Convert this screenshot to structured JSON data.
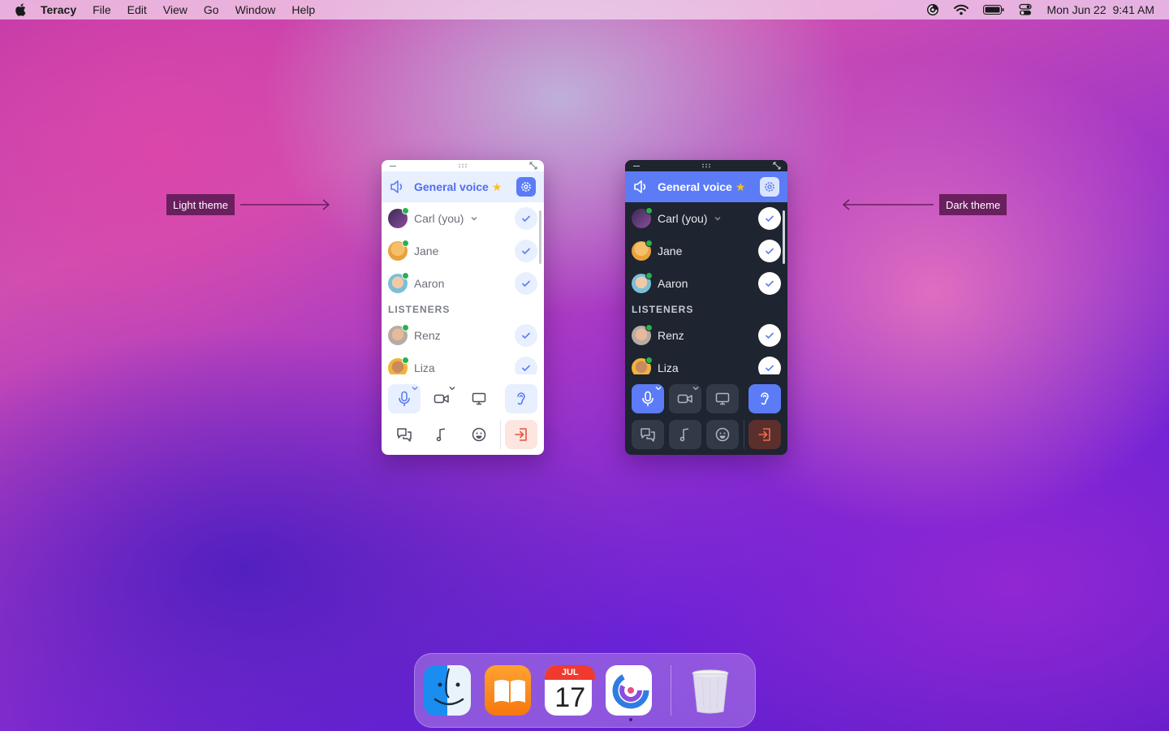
{
  "menubar": {
    "app_name": "Teracy",
    "items": [
      "File",
      "Edit",
      "View",
      "Go",
      "Window",
      "Help"
    ],
    "date": "Mon Jun 22",
    "time": "9:41 AM",
    "status_icons": [
      "teracy-icon",
      "wifi-icon",
      "battery-icon",
      "control-center-icon"
    ]
  },
  "annotations": {
    "light": "Light theme",
    "dark": "Dark theme"
  },
  "widget": {
    "channel": "General voice",
    "participants": [
      {
        "name": "Carl (you)",
        "self": true
      },
      {
        "name": "Jane"
      },
      {
        "name": "Aaron"
      }
    ],
    "listeners_label": "LISTENERS",
    "listeners": [
      {
        "name": "Renz"
      },
      {
        "name": "Liza"
      }
    ],
    "controls_row1": [
      "microphone-icon",
      "video-camera-icon",
      "screen-share-icon",
      "listen-ear-icon"
    ],
    "controls_row2": [
      "chat-icon",
      "music-icon",
      "emoji-icon",
      "leave-icon"
    ],
    "colors": {
      "accent": "#5b7cf6",
      "online": "#27b34a",
      "star": "#f5c228",
      "leave": "#e5553f",
      "dark_bg": "#1e2430"
    }
  },
  "dock": {
    "apps": [
      "Finder",
      "Books",
      "Calendar",
      "Teracy"
    ],
    "calendar_month": "JUL",
    "calendar_day": "17",
    "trash": "Trash"
  }
}
